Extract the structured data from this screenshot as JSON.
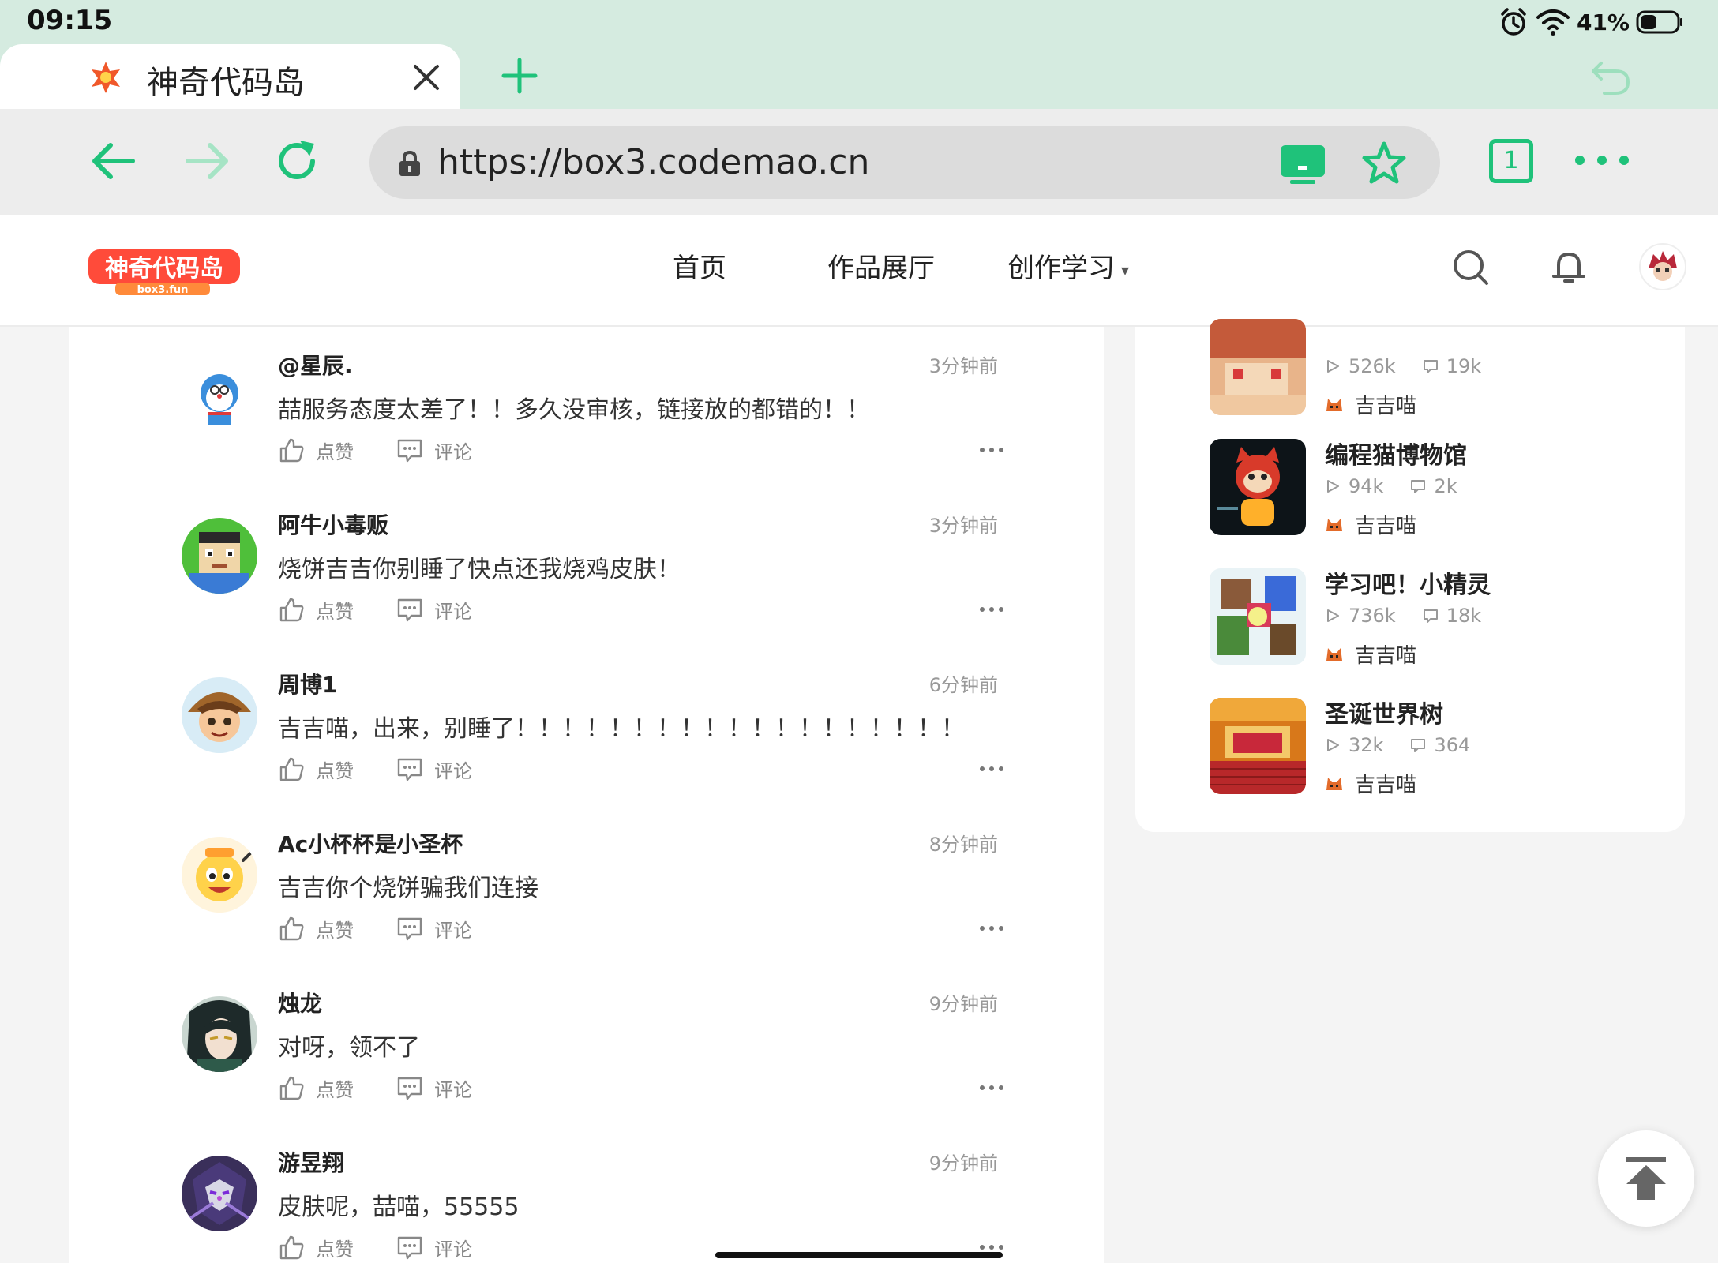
{
  "status_bar": {
    "time": "09:15",
    "battery": "41%"
  },
  "browser": {
    "tab_title": "神奇代码岛",
    "url": "https://box3.codemao.cn",
    "tab_count": "1",
    "accent_color": "#1fc27a"
  },
  "header": {
    "logo_text": "神奇代码岛 box3.fun",
    "nav": [
      {
        "label": "首页"
      },
      {
        "label": "作品展厅"
      },
      {
        "label": "创作学习"
      }
    ]
  },
  "comment_actions": {
    "like_label": "点赞",
    "reply_label": "评论"
  },
  "comments": [
    {
      "author": "@星辰.",
      "time": "3分钟前",
      "text": "喆服务态度太差了！！多久没审核，链接放的都错的！！"
    },
    {
      "author": "阿牛小毒贩",
      "time": "3分钟前",
      "text": "烧饼吉吉你别睡了快点还我烧鸡皮肤！"
    },
    {
      "author": "周博1",
      "time": "6分钟前",
      "text": "吉吉喵，出来，别睡了！！！！！！！！！！！！！！！！！！！"
    },
    {
      "author": "Ac小杯杯是小圣杯",
      "time": "8分钟前",
      "text": "吉吉你个烧饼骗我们连接"
    },
    {
      "author": "烛龙",
      "time": "9分钟前",
      "text": "对呀，领不了"
    },
    {
      "author": "游昱翔",
      "time": "9分钟前",
      "text": "皮肤呢，喆喵，55555"
    }
  ],
  "recommendations": [
    {
      "title": "",
      "plays": "526k",
      "comments": "19k",
      "author": "吉吉喵"
    },
    {
      "title": "编程猫博物馆",
      "plays": "94k",
      "comments": "2k",
      "author": "吉吉喵"
    },
    {
      "title": "学习吧！小精灵",
      "plays": "736k",
      "comments": "18k",
      "author": "吉吉喵"
    },
    {
      "title": "圣诞世界树",
      "plays": "32k",
      "comments": "364",
      "author": "吉吉喵"
    }
  ]
}
